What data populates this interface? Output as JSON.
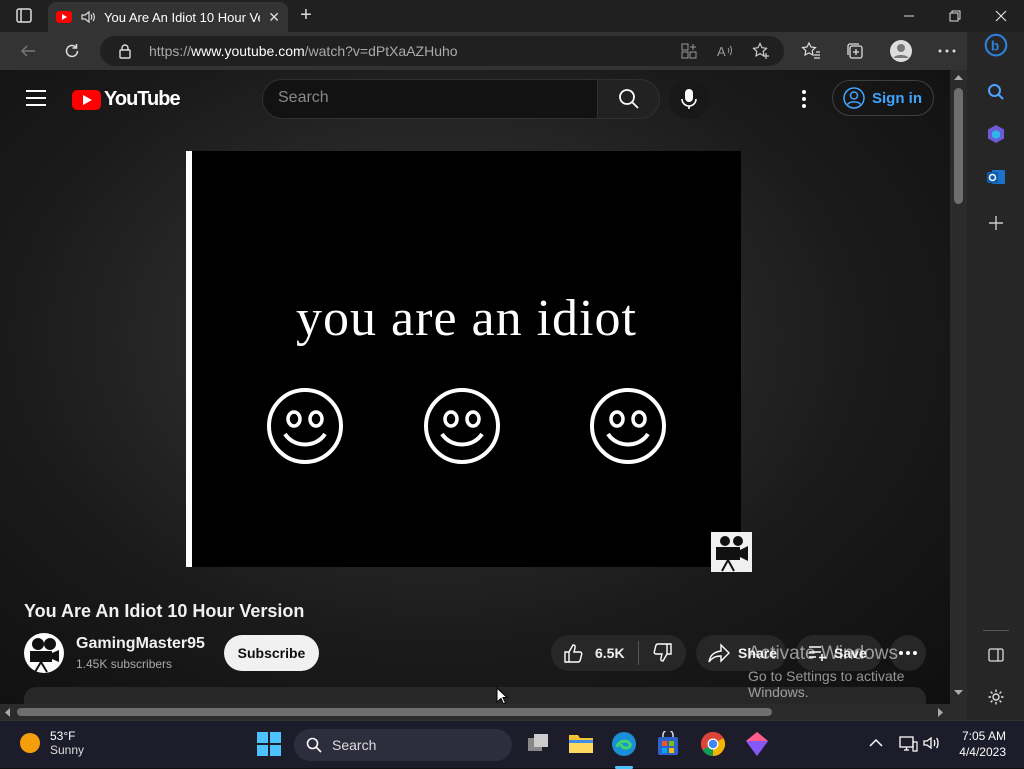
{
  "browser": {
    "tab_title": "You Are An Idiot 10 Hour Ve",
    "url_prefix": "https://",
    "url_domain": "www.youtube.com",
    "url_path": "/watch?v=dPtXaAZHuho"
  },
  "youtube": {
    "logo_text": "YouTube",
    "search_placeholder": "Search",
    "sign_in_label": "Sign in"
  },
  "video": {
    "frame_text": "you are an idiot",
    "title": "You Are An Idiot 10 Hour Version"
  },
  "channel": {
    "name": "GamingMaster95",
    "subscribers": "1.45K subscribers",
    "subscribe_label": "Subscribe"
  },
  "actions": {
    "like_count": "6.5K",
    "share_label": "Share",
    "save_label": "Save"
  },
  "watermark": {
    "line1": "Activate Windows",
    "line2": "Go to Settings to activate Windows."
  },
  "taskbar": {
    "temperature": "53°F",
    "weather": "Sunny",
    "search_label": "Search",
    "time": "7:05 AM",
    "date": "4/4/2023"
  },
  "colors": {
    "youtube_red": "#ff0000",
    "link_blue": "#3ea6ff",
    "page_bg": "#0f0f0f"
  }
}
